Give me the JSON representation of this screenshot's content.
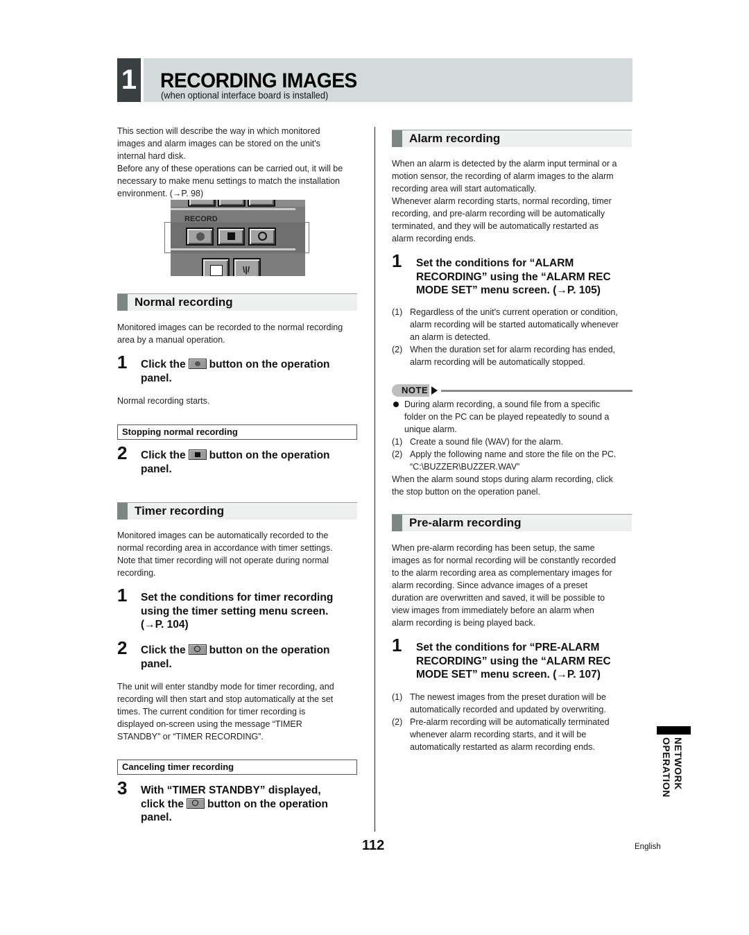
{
  "chapter": {
    "number": "1",
    "title": "RECORDING IMAGES",
    "subtitle": "(when optional interface board is installed)"
  },
  "intro": {
    "lines": [
      "This section will describe the way in which monitored",
      "images and alarm images can be stored on the unit's",
      "internal hard disk.",
      "Before any of these operations can be carried out, it will be",
      "necessary to make menu settings to match the installation",
      "environment. (→P. 98)"
    ]
  },
  "operation_panel_image": {
    "label": "RECORD",
    "buttons": [
      "record-icon",
      "stop-icon",
      "timer-icon"
    ],
    "lower_buttons": [
      "list-icon",
      "alarm-icon"
    ]
  },
  "normal_recording": {
    "heading": "Normal recording",
    "lines": [
      "Monitored images can be recorded to the normal recording",
      "area by a manual operation."
    ],
    "step1": {
      "num": "1",
      "pre": "Click the",
      "post": "button on the operation",
      "line2": "panel.",
      "icon": "record-icon"
    },
    "result": "Normal recording starts.",
    "stop_box": "Stopping normal recording",
    "step2": {
      "num": "2",
      "pre": "Click the",
      "post": "button on the operation",
      "line2": "panel.",
      "icon": "stop-icon"
    }
  },
  "timer_recording": {
    "heading": "Timer recording",
    "lines": [
      "Monitored images can be automatically recorded to the",
      "normal recording area in accordance with timer settings.",
      "Note that timer recording will not operate during normal",
      "recording."
    ],
    "step1": {
      "num": "1",
      "lines": [
        "Set the conditions for timer recording",
        "using the timer setting menu screen.",
        "(→P. 104)"
      ]
    },
    "step2": {
      "num": "2",
      "pre": "Click the",
      "post": "button on the operation",
      "line2": "panel.",
      "icon": "timer-icon"
    },
    "after_lines": [
      "The unit will enter standby mode for timer recording, and",
      "recording will then start and stop automatically at the set",
      "times. The current condition for timer recording is",
      "displayed on-screen using the message “TIMER",
      "STANDBY” or “TIMER RECORDING”."
    ],
    "cancel_box": "Canceling timer recording",
    "step3": {
      "num": "3",
      "line1": "With “TIMER STANDBY” displayed,",
      "pre": "click the",
      "post": "button on the operation",
      "line3": "panel.",
      "icon": "timer-icon"
    }
  },
  "alarm_recording": {
    "heading": "Alarm recording",
    "lines": [
      "When an alarm is detected by the alarm input terminal or a",
      "motion sensor, the recording of alarm images to the alarm",
      "recording area will start automatically.",
      "Whenever alarm recording starts, normal recording, timer",
      "recording, and pre-alarm recording will be automatically",
      "terminated, and they will be automatically restarted as",
      "alarm recording ends."
    ],
    "step1": {
      "num": "1",
      "lines": [
        "Set the conditions for “ALARM",
        "RECORDING” using the “ALARM REC",
        "MODE SET” menu screen. (→P. 105)"
      ]
    },
    "list": [
      {
        "num": "(1)",
        "lines": [
          "Regardless of the unit's current operation or condition,",
          "alarm recording will be started automatically whenever",
          "an alarm is detected."
        ]
      },
      {
        "num": "(2)",
        "lines": [
          "When the duration set for alarm recording has ended,",
          "alarm recording will be automatically stopped."
        ]
      }
    ]
  },
  "note": {
    "label": "NOTE",
    "bullet": [
      "During alarm recording, a sound file from a specific",
      "folder on the PC can be played repeatedly to sound a",
      "unique alarm."
    ],
    "list": [
      {
        "num": "(1)",
        "lines": [
          "Create a sound file (WAV) for the alarm."
        ]
      },
      {
        "num": "(2)",
        "lines": [
          "Apply the following name and store the file on the PC.",
          "“C:\\BUZZER\\BUZZER.WAV”"
        ]
      }
    ],
    "after_lines": [
      "When the alarm sound stops during alarm recording, click",
      "the stop button on the operation panel."
    ]
  },
  "prealarm_recording": {
    "heading": "Pre-alarm recording",
    "lines": [
      "When pre-alarm recording has been setup, the same",
      "images as for normal recording will be constantly recorded",
      "to the alarm recording area as complementary images for",
      "alarm recording. Since advance images of a preset",
      "duration are overwritten and saved, it will be possible to",
      "view images from immediately before an alarm when",
      "alarm recording is being played back."
    ],
    "step1": {
      "num": "1",
      "lines": [
        "Set the conditions for “PRE-ALARM",
        "RECORDING” using the “ALARM REC",
        "MODE SET” menu screen. (→P. 107)"
      ]
    },
    "list": [
      {
        "num": "(1)",
        "lines": [
          "The newest images from the preset duration will be",
          "automatically recorded and updated by overwriting."
        ]
      },
      {
        "num": "(2)",
        "lines": [
          "Pre-alarm recording will be automatically terminated",
          "whenever alarm recording starts, and it will be",
          "automatically restarted as alarm recording ends."
        ]
      }
    ]
  },
  "side_tab": {
    "line1": "NETWORK",
    "line2": "OPERATION"
  },
  "footer": {
    "page_number": "112",
    "language": "English"
  }
}
